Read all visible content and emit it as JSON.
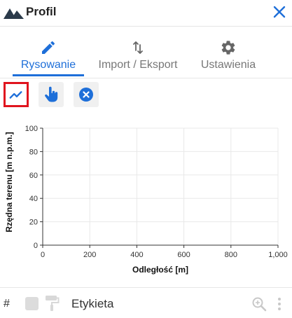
{
  "header": {
    "title": "Profil",
    "logo_icon": "mountains-icon",
    "close_icon": "close-icon",
    "accent_color": "#1e6fd9"
  },
  "tabs": [
    {
      "label": "Rysowanie",
      "icon": "pencil-icon",
      "active": true
    },
    {
      "label": "Import / Eksport",
      "icon": "up-down-arrows-icon",
      "active": false
    },
    {
      "label": "Ustawienia",
      "icon": "gear-icon",
      "active": false
    }
  ],
  "toolbar": {
    "buttons": [
      {
        "icon": "draw-line-icon",
        "selected": true
      },
      {
        "icon": "hand-pointer-icon",
        "selected": false
      },
      {
        "icon": "clear-circle-icon",
        "selected": false
      }
    ],
    "selected_color": "#e0141e"
  },
  "chart_data": {
    "type": "line",
    "title": "",
    "xlabel": "Odległość [m]",
    "ylabel": "Rzędna terenu [m n.p.m.]",
    "xlim": [
      0,
      1000
    ],
    "ylim": [
      0,
      100
    ],
    "x_ticks": [
      "0",
      "200",
      "400",
      "600",
      "800",
      "1,000"
    ],
    "y_ticks": [
      "0",
      "20",
      "40",
      "60",
      "80",
      "100"
    ],
    "grid": true,
    "series": []
  },
  "footer": {
    "hash": "#",
    "label": "Etykieta",
    "icons": [
      "checkbox-icon",
      "paint-roller-icon",
      "zoom-icon",
      "more-vertical-icon"
    ]
  }
}
